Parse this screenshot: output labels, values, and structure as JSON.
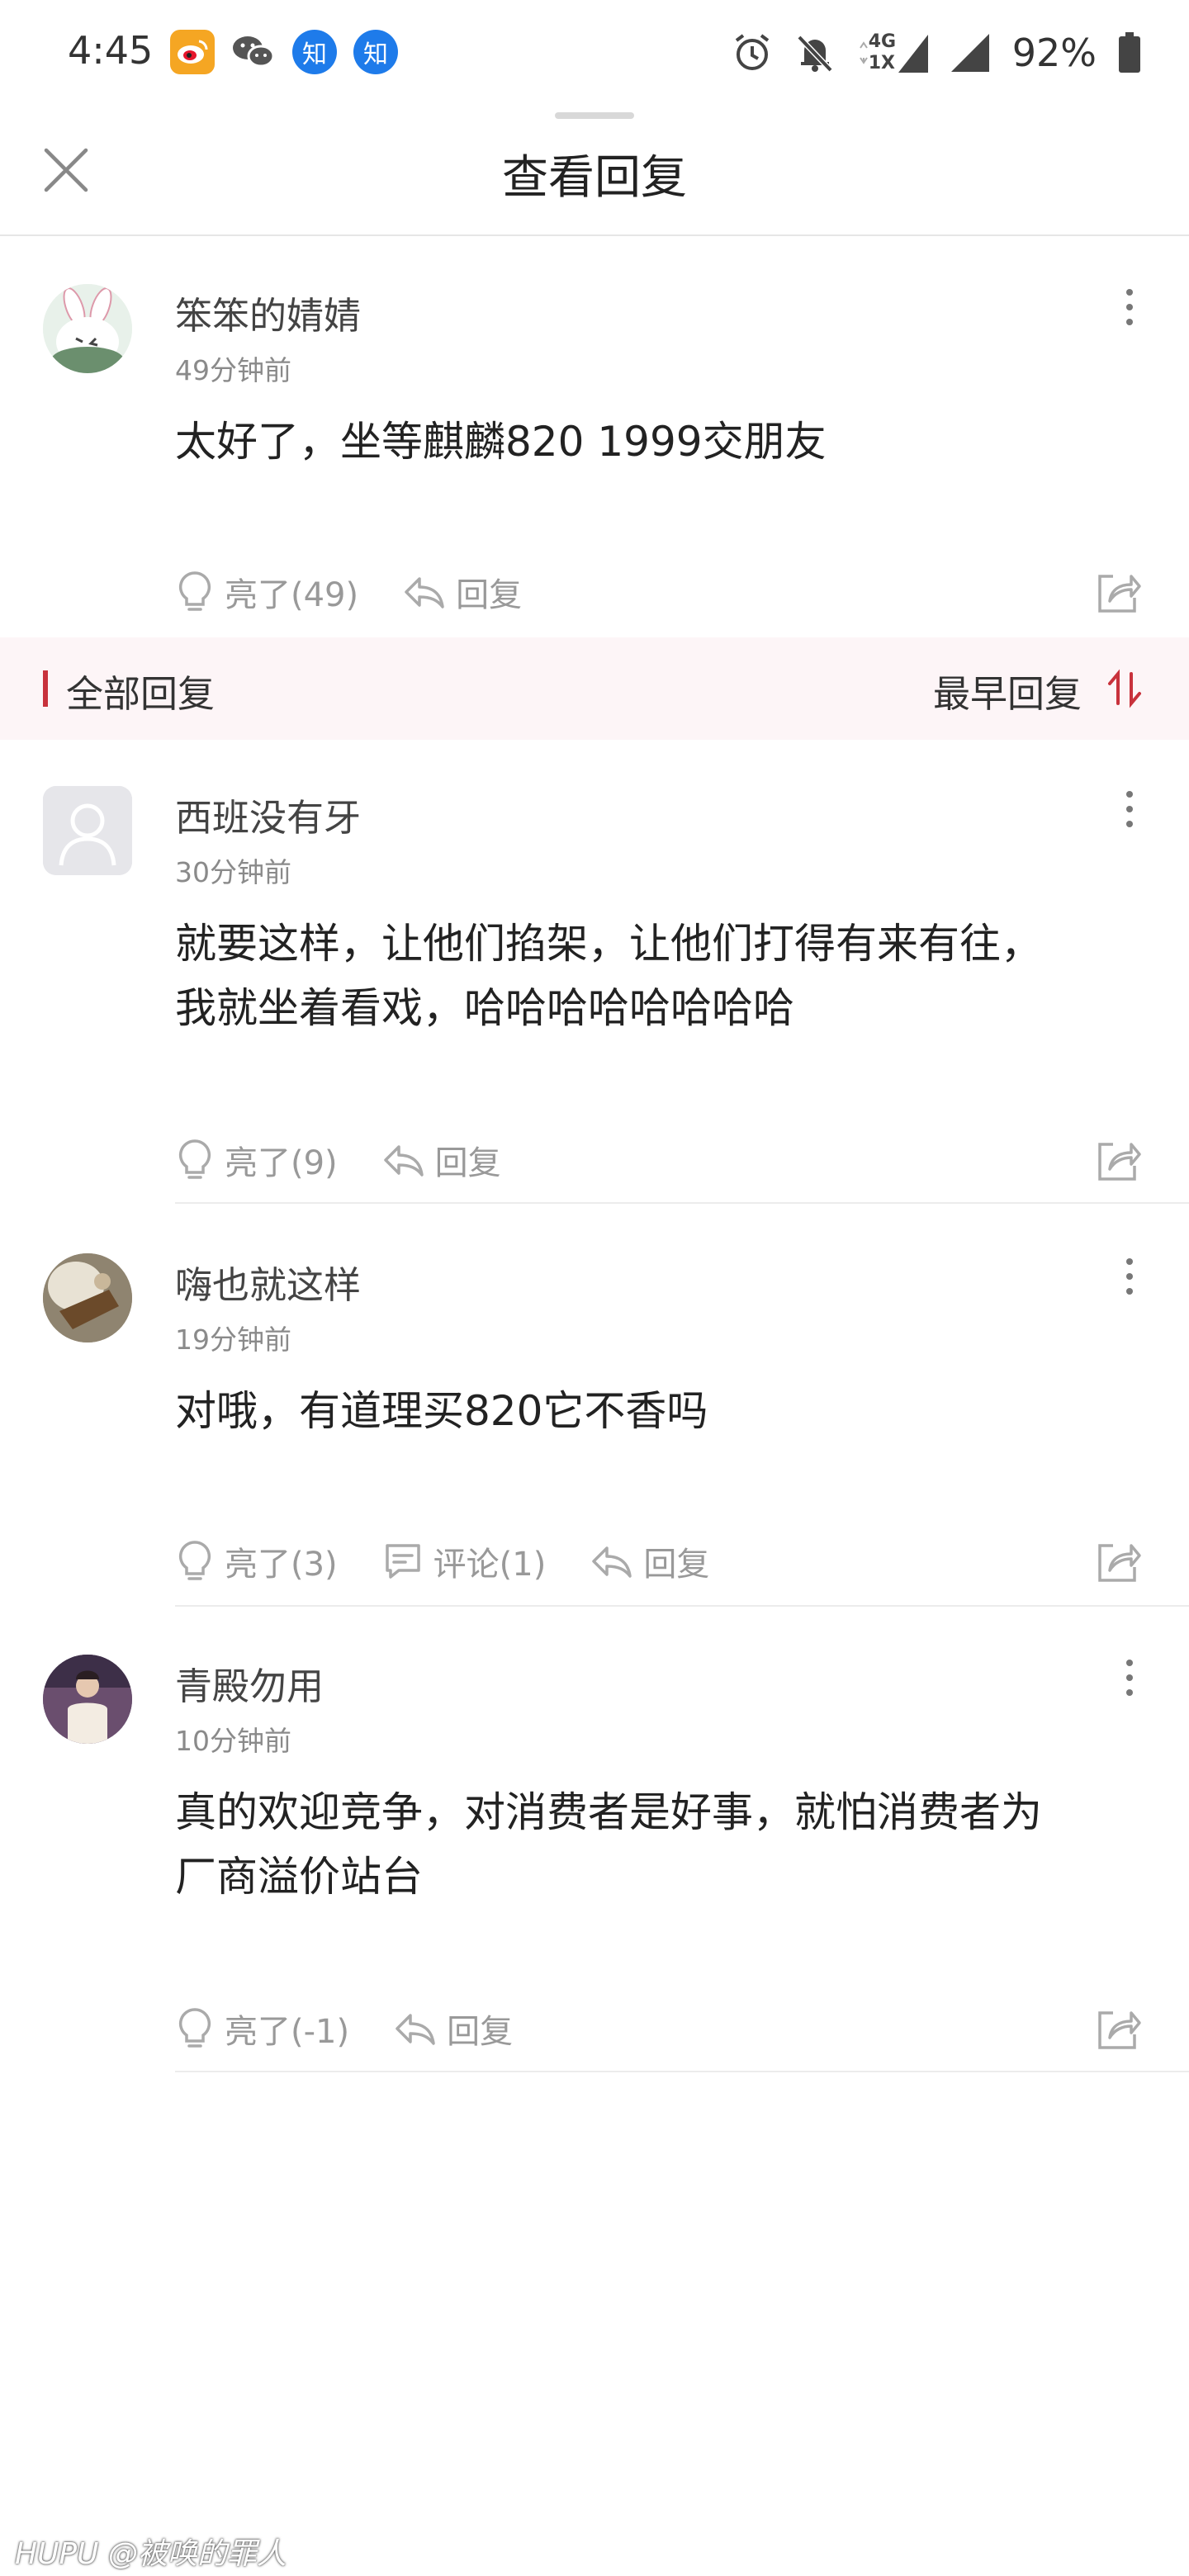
{
  "status_bar": {
    "time": "4:45",
    "apps": [
      "weibo-icon",
      "wechat-icon",
      "zhihu-icon",
      "zhihu-icon"
    ],
    "zhihu_glyph": "知",
    "network_label_top": "4G",
    "network_label_bottom": "1X",
    "battery": "92%",
    "colors": {
      "weibo": "#f5a623",
      "zhihu": "#1e7bea"
    }
  },
  "nav": {
    "title": "查看回复",
    "close_icon": "close-icon"
  },
  "main_post": {
    "username": "笨笨的婧婧",
    "time": "49分钟前",
    "text": "太好了，坐等麒麟820 1999交朋友",
    "like_label": "亮了(49)",
    "reply_label": "回复"
  },
  "section": {
    "title": "全部回复",
    "sort_label": "最早回复",
    "accent": "#c8323c"
  },
  "replies": [
    {
      "username": "西班没有牙",
      "time": "30分钟前",
      "text_line1": "就要这样，让他们掐架，让他们打得有来有往，",
      "text_line2": "我就坐着看戏，哈哈哈哈哈哈哈哈",
      "like_label": "亮了(9)",
      "reply_label": "回复"
    },
    {
      "username": "嗨也就这样",
      "time": "19分钟前",
      "text_line1": "对哦，有道理买820它不香吗",
      "like_label": "亮了(3)",
      "comment_label": "评论(1)",
      "reply_label": "回复"
    },
    {
      "username": "青殿勿用",
      "time": "10分钟前",
      "text_line1": "真的欢迎竞争，对消费者是好事，就怕消费者为",
      "text_line2": "厂商溢价站台",
      "like_label": "亮了(-1)",
      "reply_label": "回复"
    }
  ],
  "watermark": "HUPU @被唤的罪人"
}
